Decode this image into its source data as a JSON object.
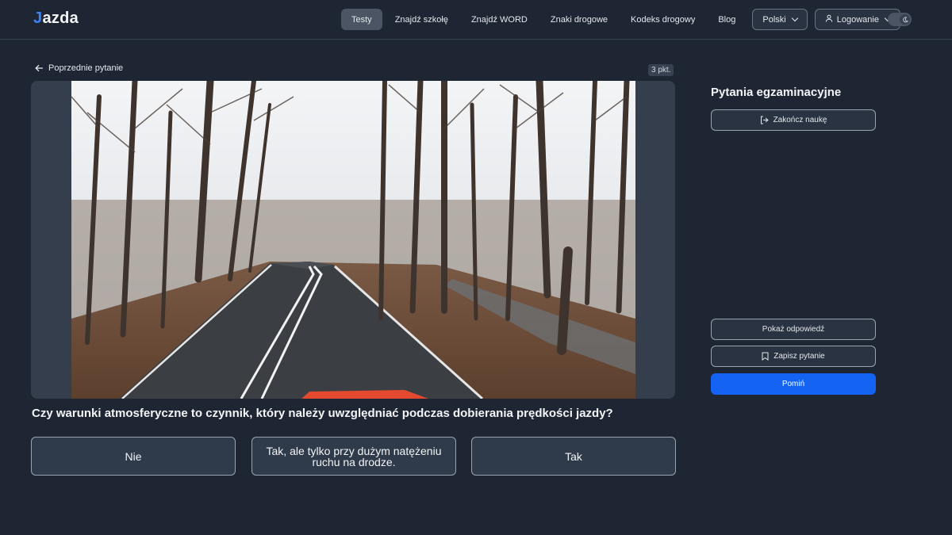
{
  "header": {
    "logo_mark": "J",
    "logo_text": "azda",
    "nav": [
      "Testy",
      "Znajdź szkołę",
      "Znajdź WORD",
      "Znaki drogowe",
      "Kodeks drogowy",
      "Blog"
    ],
    "active_nav": "Testy",
    "language_label": "Polski",
    "login_label": "Logowanie",
    "theme_toggle": "dark"
  },
  "main": {
    "prev_label": "Poprzednie pytanie",
    "points_label": "3 pkt.",
    "question": "Czy warunki atmosferyczne to czynnik, który należy uwzględniać podczas dobierania prędkości jazdy?",
    "answers": [
      "Nie",
      "Tak, ale tylko przy dużym natężeniu ruchu na drodze.",
      "Tak"
    ]
  },
  "side": {
    "title": "Pytania egzaminacyjne",
    "end_label": "Zakończ naukę",
    "show_label": "Pokaż odpowiedź",
    "save_label": "Zapisz pytanie",
    "skip_label": "Pomiń"
  },
  "colors": {
    "background": "#1e2633",
    "primary": "#1463f3",
    "active_nav": "#4b5563"
  }
}
